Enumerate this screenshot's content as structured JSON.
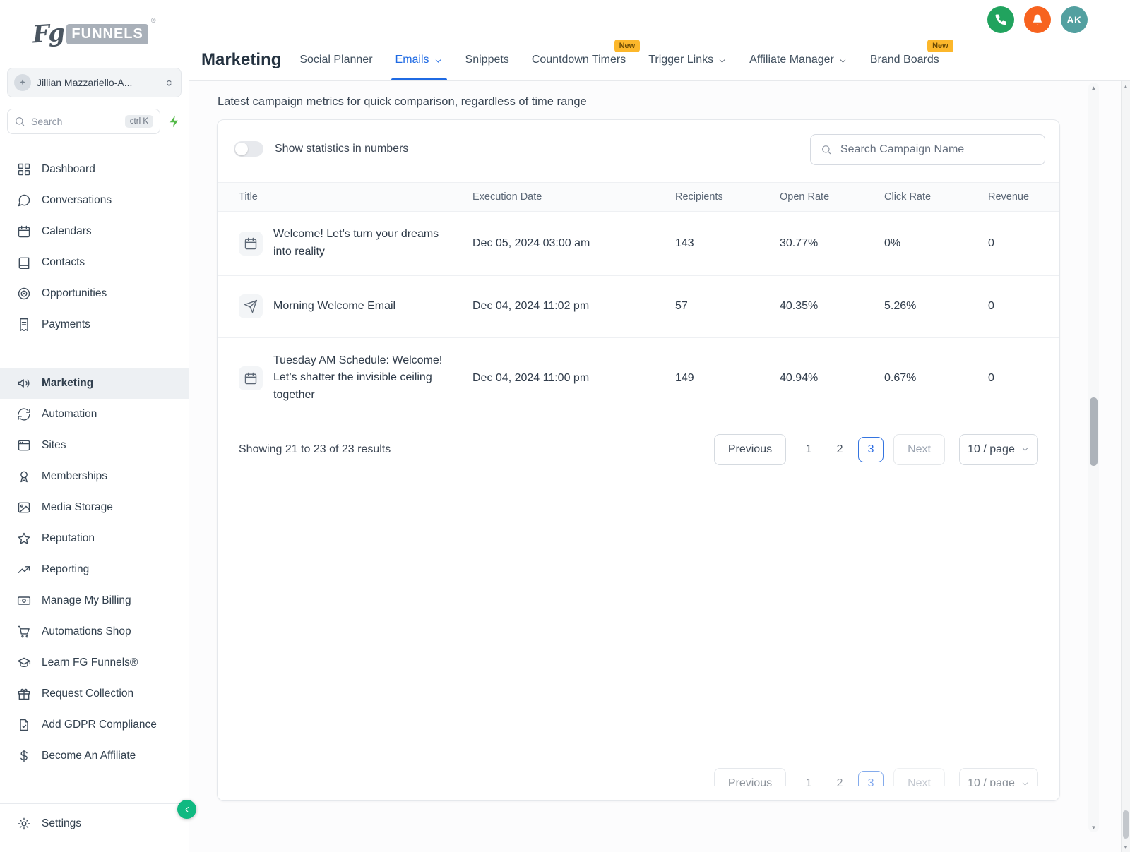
{
  "brand": {
    "logo_script": "Fg",
    "logo_text": "FUNNELS",
    "logo_reg": "®"
  },
  "sidebar": {
    "account_name": "Jillian Mazzariello-A...",
    "search": {
      "placeholder": "Search",
      "shortcut": "ctrl K"
    },
    "sections": [
      {
        "items": [
          {
            "label": "Dashboard",
            "icon": "grid"
          },
          {
            "label": "Conversations",
            "icon": "chat"
          },
          {
            "label": "Calendars",
            "icon": "calendar"
          },
          {
            "label": "Contacts",
            "icon": "book"
          },
          {
            "label": "Opportunities",
            "icon": "target"
          },
          {
            "label": "Payments",
            "icon": "receipt"
          }
        ]
      },
      {
        "items": [
          {
            "label": "Marketing",
            "icon": "speaker",
            "active": true
          },
          {
            "label": "Automation",
            "icon": "sync"
          },
          {
            "label": "Sites",
            "icon": "browser"
          },
          {
            "label": "Memberships",
            "icon": "medal"
          },
          {
            "label": "Media Storage",
            "icon": "image"
          },
          {
            "label": "Reputation",
            "icon": "star"
          },
          {
            "label": "Reporting",
            "icon": "trend"
          },
          {
            "label": "Manage My Billing",
            "icon": "banknote"
          },
          {
            "label": "Automations Shop",
            "icon": "cart"
          },
          {
            "label": "Learn FG Funnels®",
            "icon": "grad"
          },
          {
            "label": "Request Collection",
            "icon": "gift"
          },
          {
            "label": "Add GDPR Compliance",
            "icon": "doc"
          },
          {
            "label": "Become An Affiliate",
            "icon": "dollar"
          }
        ]
      }
    ],
    "settings_label": "Settings"
  },
  "header": {
    "title": "Marketing",
    "tabs": [
      {
        "label": "Social Planner"
      },
      {
        "label": "Emails",
        "active": true,
        "chevron": true
      },
      {
        "label": "Snippets"
      },
      {
        "label": "Countdown Timers",
        "badge": "New"
      },
      {
        "label": "Trigger Links",
        "chevron": true
      },
      {
        "label": "Affiliate Manager",
        "chevron": true
      },
      {
        "label": "Brand Boards",
        "badge": "New"
      }
    ],
    "avatar_initials": "AK"
  },
  "main": {
    "description": "Latest campaign metrics for quick comparison, regardless of time range",
    "toggle_label": "Show statistics in numbers",
    "search_placeholder": "Search Campaign Name",
    "table": {
      "columns": [
        "Title",
        "Execution Date",
        "Recipients",
        "Open Rate",
        "Click Rate",
        "Revenue"
      ],
      "rows": [
        {
          "icon": "calendar",
          "title": "Welcome! Let’s turn your dreams into reality",
          "date": "Dec 05, 2024 03:00 am",
          "recipients": "143",
          "open_rate": "30.77%",
          "click_rate": "0%",
          "revenue": "0"
        },
        {
          "icon": "send",
          "title": "Morning Welcome Email",
          "date": "Dec 04, 2024 11:02 pm",
          "recipients": "57",
          "open_rate": "40.35%",
          "click_rate": "5.26%",
          "revenue": "0"
        },
        {
          "icon": "calendar",
          "title": "Tuesday AM Schedule: Welcome! Let’s shatter the invisible ceiling together",
          "date": "Dec 04, 2024 11:00 pm",
          "recipients": "149",
          "open_rate": "40.94%",
          "click_rate": "0.67%",
          "revenue": "0"
        }
      ]
    },
    "pagination": {
      "summary": "Showing 21 to 23 of 23 results",
      "previous": "Previous",
      "pages": [
        "1",
        "2",
        "3"
      ],
      "active_page": "3",
      "next": "Next",
      "page_size": "10 / page"
    }
  },
  "colors": {
    "accent_blue": "#1f6ae3",
    "badge_amber": "#fcb72b",
    "phone_green": "#21a35e",
    "bell_orange": "#f7631f",
    "avatar_teal": "#53a0a0",
    "collapse_green": "#10b981"
  }
}
